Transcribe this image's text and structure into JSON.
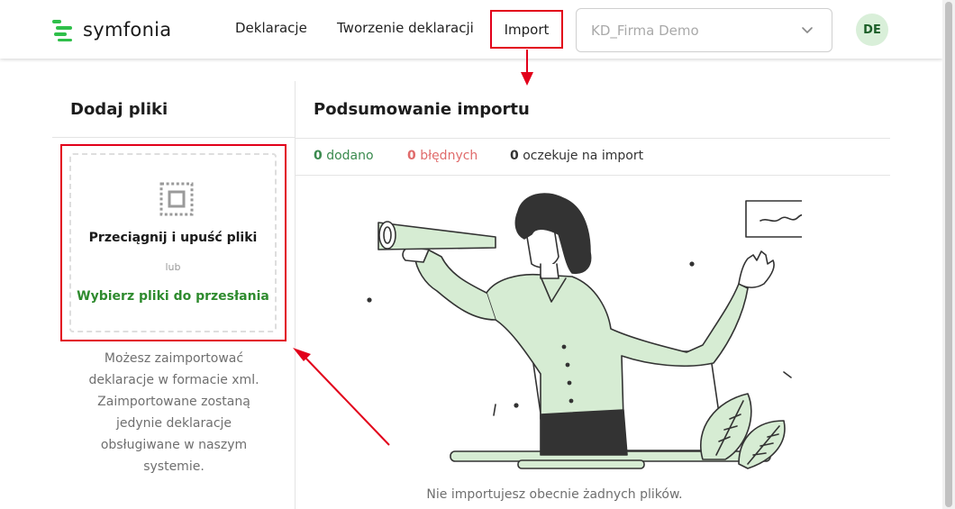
{
  "header": {
    "logo_text": "symfonia",
    "nav": {
      "declarations": "Deklaracje",
      "create_declarations": "Tworzenie deklaracji",
      "import": "Import"
    },
    "company_select_value": "KD_Firma Demo",
    "avatar_initials": "DE"
  },
  "left": {
    "title": "Dodaj pliki",
    "drop_title": "Przeciągnij i upuść pliki",
    "drop_or": "lub",
    "drop_link": "Wybierz pliki do przesłania",
    "help_text": "Możesz zaimportować deklaracje w formacie xml. Zaimportowane zostaną jedynie deklaracje obsługiwane w naszym systemie."
  },
  "right": {
    "title": "Podsumowanie importu",
    "stats": {
      "added_count": "0",
      "added_label": "dodano",
      "errors_count": "0",
      "errors_label": "błędnych",
      "pending_count": "0",
      "pending_label": "oczekuje na import"
    },
    "empty_message": "Nie importujesz obecnie żadnych plików."
  },
  "colors": {
    "brand_green": "#2fbf4a",
    "highlight_red": "#e2001a",
    "link_green": "#2e8b2e",
    "error_red": "#e06b6b",
    "illustration_green": "#d6ecd3"
  }
}
